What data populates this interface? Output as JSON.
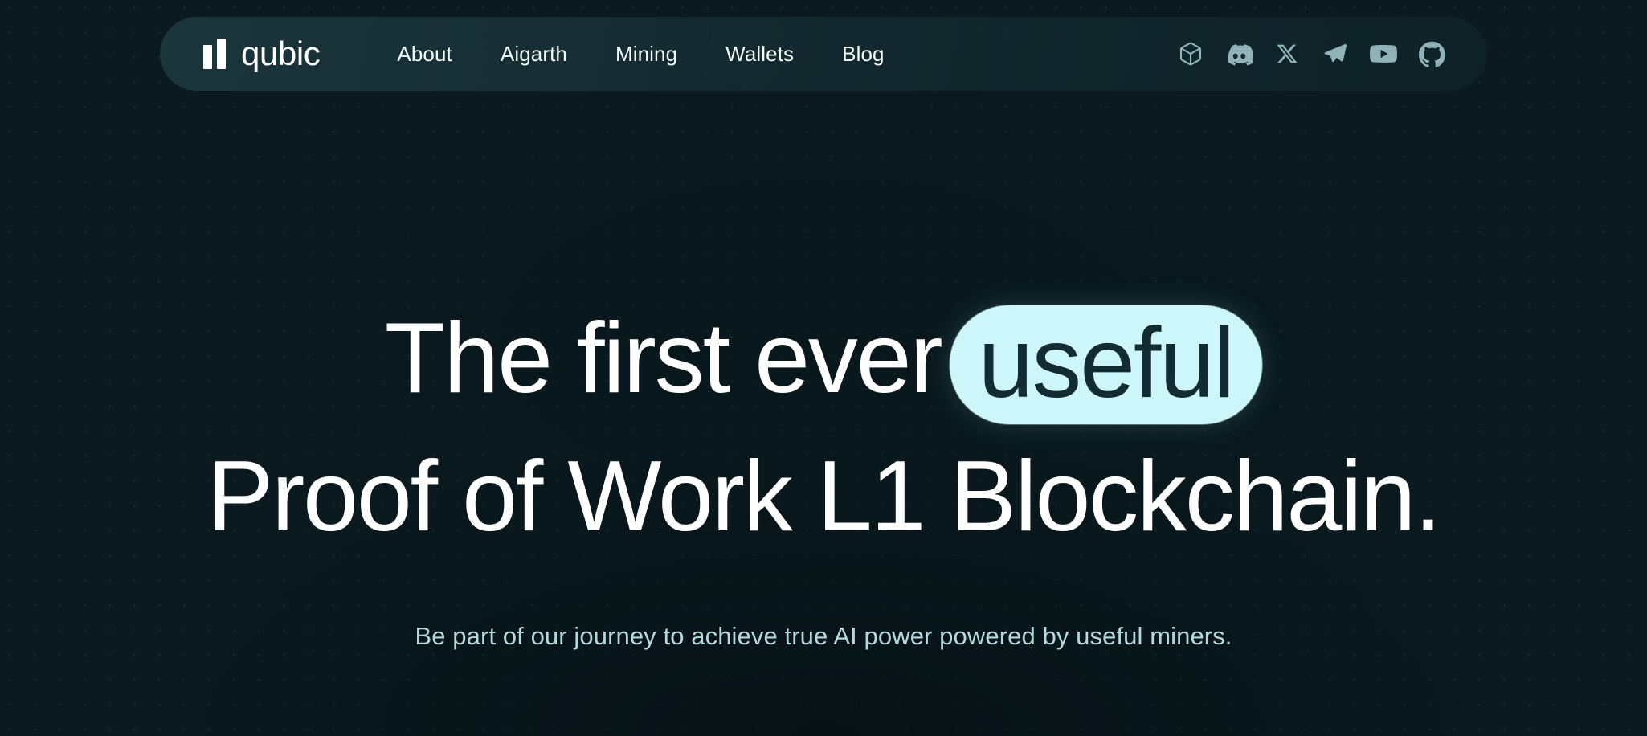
{
  "site": {
    "brand": "qubic",
    "logo_icon": "qubic-bars-logo"
  },
  "header": {
    "nav": [
      {
        "label": "About",
        "name": "nav-link-about"
      },
      {
        "label": "Aigarth",
        "name": "nav-link-aigarth"
      },
      {
        "label": "Mining",
        "name": "nav-link-mining"
      },
      {
        "label": "Wallets",
        "name": "nav-link-wallets"
      },
      {
        "label": "Blog",
        "name": "nav-link-blog"
      }
    ],
    "socials": [
      {
        "icon": "cube-explorer-icon"
      },
      {
        "icon": "discord-icon"
      },
      {
        "icon": "x-twitter-icon"
      },
      {
        "icon": "telegram-icon"
      },
      {
        "icon": "youtube-icon"
      },
      {
        "icon": "github-icon"
      }
    ]
  },
  "hero": {
    "headline_line1_prefix": "The first ever",
    "headline_highlight": "useful",
    "headline_line2": "Proof of Work L1 Blockchain.",
    "subtitle": "Be part of our journey to achieve true AI power powered by useful miners."
  },
  "colors": {
    "background": "#0a1a1f",
    "navbar": "#1d383f",
    "accent": "#cdf6fb",
    "accent_text": "#132b32",
    "text_primary": "#ffffff",
    "text_muted": "#b6d9de",
    "icon_muted": "#8fb3b8"
  }
}
